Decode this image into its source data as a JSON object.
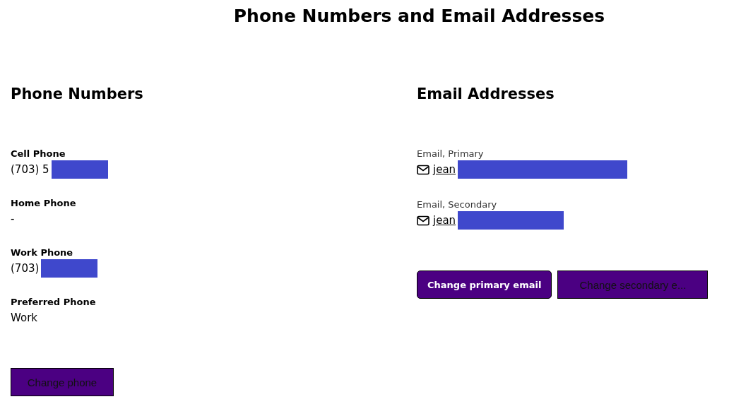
{
  "title": "Phone Numbers and Email Addresses",
  "phone_section": {
    "heading": "Phone Numbers",
    "fields": [
      {
        "label": "Cell Phone",
        "value": "(703) 5",
        "redacted": true
      },
      {
        "label": "Home Phone",
        "value": "-",
        "redacted": false
      },
      {
        "label": "Work Phone",
        "value": "(703)",
        "redacted": true
      },
      {
        "label": "Preferred Phone",
        "value": "Work",
        "redacted": false
      }
    ],
    "buttons": [
      {
        "label": "Change phone",
        "kind": "plain"
      }
    ]
  },
  "email_section": {
    "heading": "Email Addresses",
    "fields": [
      {
        "label": "Email, Primary",
        "value": "jean",
        "redacted": true
      },
      {
        "label": "Email, Secondary",
        "value": "jean",
        "redacted": true
      }
    ],
    "buttons": [
      {
        "label": "Change primary email",
        "kind": "primary"
      },
      {
        "label": "Change secondary e...",
        "kind": "plain"
      }
    ]
  }
}
